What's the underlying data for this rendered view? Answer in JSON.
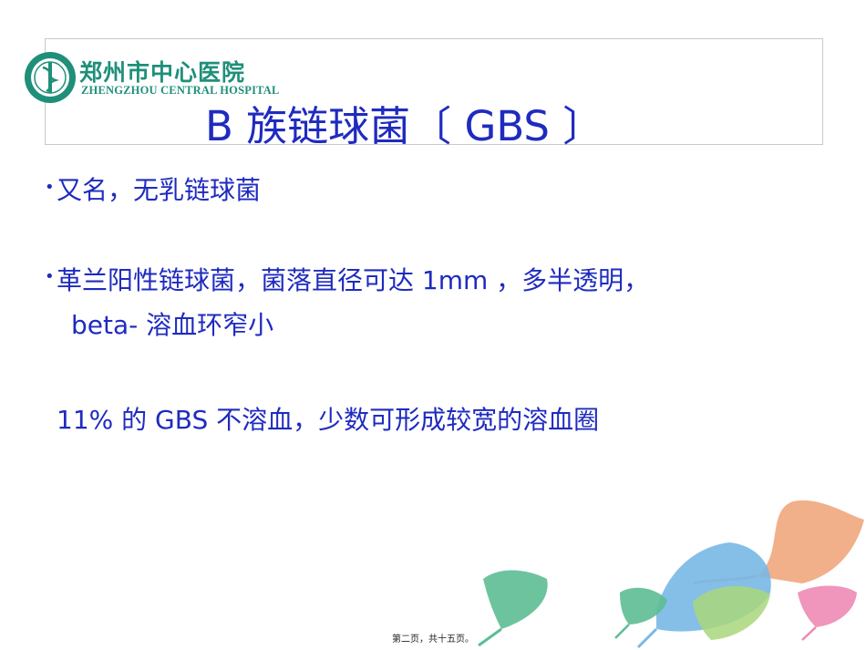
{
  "header": {
    "logo_cn": "郑州市中心医院",
    "logo_en": "ZHENGZHOU CENTRAL HOSPITAL"
  },
  "slide": {
    "title": "B 族链球菌〔 GBS 〕",
    "bullets": [
      "又名，无乳链球菌",
      "革兰阳性链球菌，菌落直径可达 1mm ，多半透明，",
      "beta- 溶血环窄小",
      "11% 的 GBS 不溶血，少数可形成较宽的溶血圈"
    ]
  },
  "footer": {
    "page_label": "第二页，共十五页。"
  },
  "colors": {
    "title_blue": "#1f2bbf",
    "logo_green": "#1f8f7a",
    "leaf_orange": "#f0a77c",
    "leaf_blue": "#78b8e6",
    "leaf_green": "#5dbd93",
    "leaf_lime": "#a9d77b",
    "leaf_pink": "#ee89b4"
  }
}
